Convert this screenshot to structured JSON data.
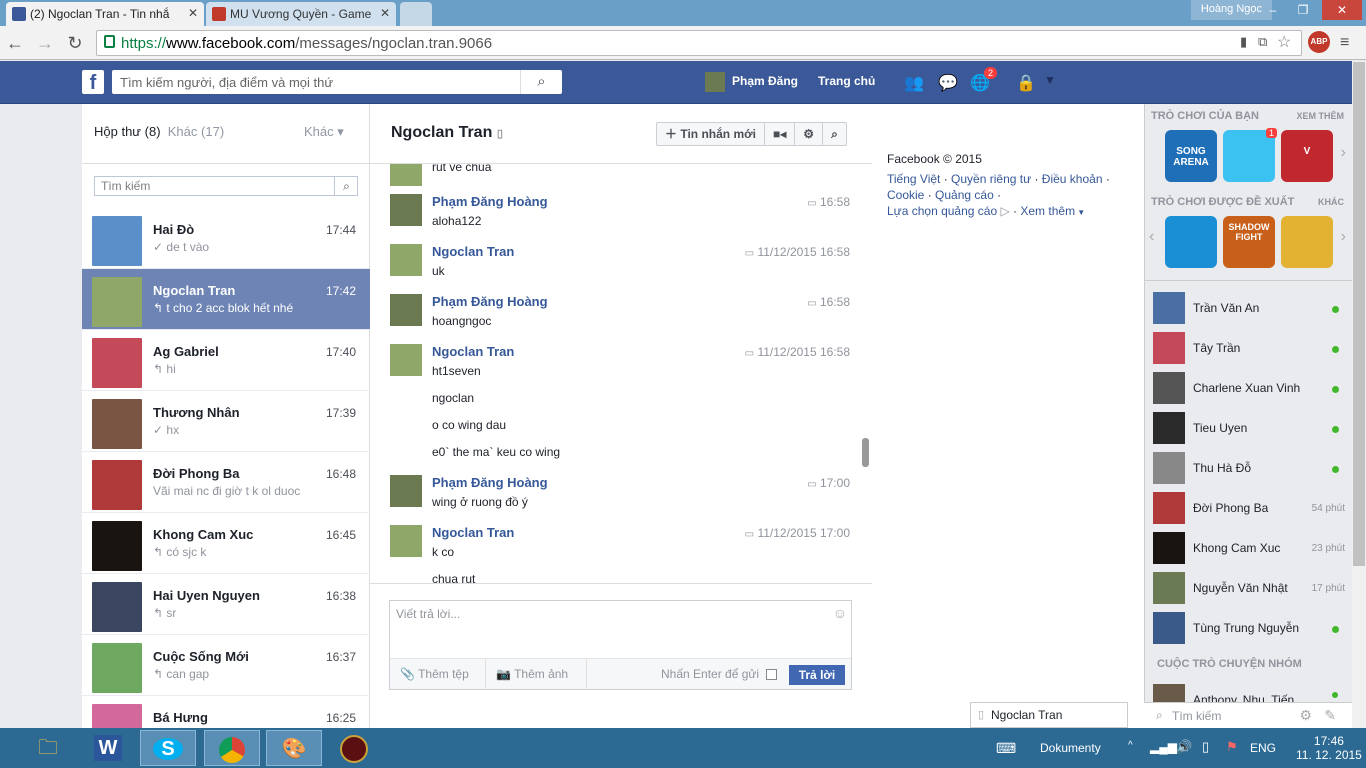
{
  "browser": {
    "tabs": [
      {
        "label": "(2) Ngoclan Tran - Tin nhắ",
        "fav_color": "#3b5998"
      },
      {
        "label": "MU Vương Quyền - Game",
        "fav_color": "#c0392b"
      }
    ],
    "profile_name": "Hoàng Ngọc",
    "url_proto": "https://",
    "url_host": "www.facebook.com",
    "url_path": "/messages/ngoclan.tran.9066",
    "abp_label": "ABP"
  },
  "header": {
    "search_placeholder": "Tìm kiếm người, địa điểm và mọi thứ",
    "user_name": "Phạm Đăng",
    "home_label": "Trang chủ",
    "notif_count": "2"
  },
  "inbox": {
    "tab_inbox": "Hộp thư",
    "tab_inbox_count": "(8)",
    "tab_other": "Khác",
    "tab_other_count": "(17)",
    "more_label": "Khác ▾",
    "search_placeholder": "Tìm kiếm",
    "threads": [
      {
        "name": "Hai Đò",
        "time": "17:44",
        "snippet": "✓ de t vào",
        "color": "#5b8fc9"
      },
      {
        "name": "Ngoclan Tran",
        "time": "17:42",
        "snippet": "↰ t cho 2 acc blok hết nhé",
        "color": "#8fa86a",
        "selected": true
      },
      {
        "name": "Ag Gabriel",
        "time": "17:40",
        "snippet": "↰ hi",
        "color": "#c44a5a"
      },
      {
        "name": "Thương Nhân",
        "time": "17:39",
        "snippet": "✓ hx",
        "color": "#7a5544"
      },
      {
        "name": "Đời Phong Ba",
        "time": "16:48",
        "snippet": "Vãi mai nc đi giờ t k ol duoc",
        "color": "#b03a3a"
      },
      {
        "name": "Khong Cam Xuc",
        "time": "16:45",
        "snippet": "↰ có sjc k",
        "color": "#1a1410"
      },
      {
        "name": "Hai Uyen Nguyen",
        "time": "16:38",
        "snippet": "↰ sr",
        "color": "#3a4560"
      },
      {
        "name": "Cuộc Sống Mới",
        "time": "16:37",
        "snippet": "↰ can gap",
        "color": "#6fa860"
      },
      {
        "name": "Bá Hưng",
        "time": "16:25",
        "snippet": "",
        "color": "#d2699a"
      }
    ]
  },
  "conversation": {
    "title": "Ngoclan Tran",
    "new_message_label": "Tin nhắn mới",
    "messages": [
      {
        "name": "",
        "time": "",
        "lines": [
          "rut ve chua"
        ],
        "who": "b"
      },
      {
        "name": "Phạm Đăng Hoàng",
        "time": "16:58",
        "lines": [
          "aloha122"
        ],
        "who": "a"
      },
      {
        "name": "Ngoclan Tran",
        "time": "11/12/2015 16:58",
        "lines": [
          "uk"
        ],
        "who": "b"
      },
      {
        "name": "Phạm Đăng Hoàng",
        "time": "16:58",
        "lines": [
          "hoangngoc"
        ],
        "who": "a"
      },
      {
        "name": "Ngoclan Tran",
        "time": "11/12/2015 16:58",
        "lines": [
          "ht1seven",
          "ngoclan",
          "o co wing dau",
          "e0` the ma` keu co wing"
        ],
        "who": "b"
      },
      {
        "name": "Phạm Đăng Hoàng",
        "time": "17:00",
        "lines": [
          "wing ở ruong đồ ý"
        ],
        "who": "a"
      },
      {
        "name": "Ngoclan Tran",
        "time": "11/12/2015 17:00",
        "lines": [
          "k co",
          "chua rut"
        ],
        "who": "b"
      }
    ],
    "composer_placeholder": "Viết trả lời...",
    "attach_file": "Thêm tệp",
    "attach_photo": "Thêm ảnh",
    "enter_to_send": "Nhấn Enter để gửi",
    "reply_label": "Trả lời"
  },
  "footer": {
    "copyright": "Facebook © 2015",
    "links_row1": [
      "Tiếng Việt",
      "Quyền riêng tư",
      "Điều khoản"
    ],
    "links_row2": [
      "Cookie",
      "Quảng cáo"
    ],
    "links_row3": [
      "Lựa chọn quảng cáo",
      "Xem thêm"
    ]
  },
  "chat_sidebar": {
    "games_title": "TRÒ CHƠI CỦA BẠN",
    "games_more": "XEM THÊM",
    "suggested_title": "TRÒ CHƠI ĐƯỢC ĐỀ XUẤT",
    "suggested_more": "KHÁC",
    "games": [
      {
        "label": "SONG ARENA",
        "color": "#1e6fb8"
      },
      {
        "label": "",
        "color": "#3cc2f0",
        "badge": "1"
      },
      {
        "label": "V",
        "color": "#c0282d"
      }
    ],
    "suggested": [
      {
        "label": "",
        "color": "#1a8fd6"
      },
      {
        "label": "SHADOW FIGHT",
        "color": "#c8601a"
      },
      {
        "label": "",
        "color": "#e3b232"
      }
    ],
    "contacts": [
      {
        "name": "Trần Văn An",
        "status": "online",
        "color": "#4a6fa5"
      },
      {
        "name": "Tây Trần",
        "status": "online",
        "color": "#c44a5a"
      },
      {
        "name": "Charlene Xuan Vinh",
        "status": "online",
        "color": "#555555"
      },
      {
        "name": "Tieu Uyen",
        "status": "online",
        "color": "#2a2a2a"
      },
      {
        "name": "Thu Hà Đỗ",
        "status": "online",
        "color": "#888888"
      },
      {
        "name": "Đời Phong Ba",
        "status": "54 phút",
        "color": "#b03a3a"
      },
      {
        "name": "Khong Cam Xuc",
        "status": "23 phút",
        "color": "#1a1410"
      },
      {
        "name": "Nguyễn Văn Nhật",
        "status": "17 phút",
        "color": "#6a7a55"
      },
      {
        "name": "Tùng Trung Nguyễn",
        "status": "online",
        "color": "#3a5a8a"
      }
    ],
    "group_title": "CUỘC TRÒ CHUYỆN NHÓM",
    "group_item": "Anthony, Nhu, Tiến",
    "search_placeholder": "Tìm kiếm",
    "chat_tab": "Ngoclan Tran"
  },
  "taskbar": {
    "documents": "Dokumenty",
    "language": "ENG",
    "time": "17:46",
    "date": "11. 12. 2015"
  },
  "colors": {
    "fb_blue": "#3b5998",
    "link": "#365899",
    "selected": "#6d84b4",
    "online": "#42b72a"
  }
}
